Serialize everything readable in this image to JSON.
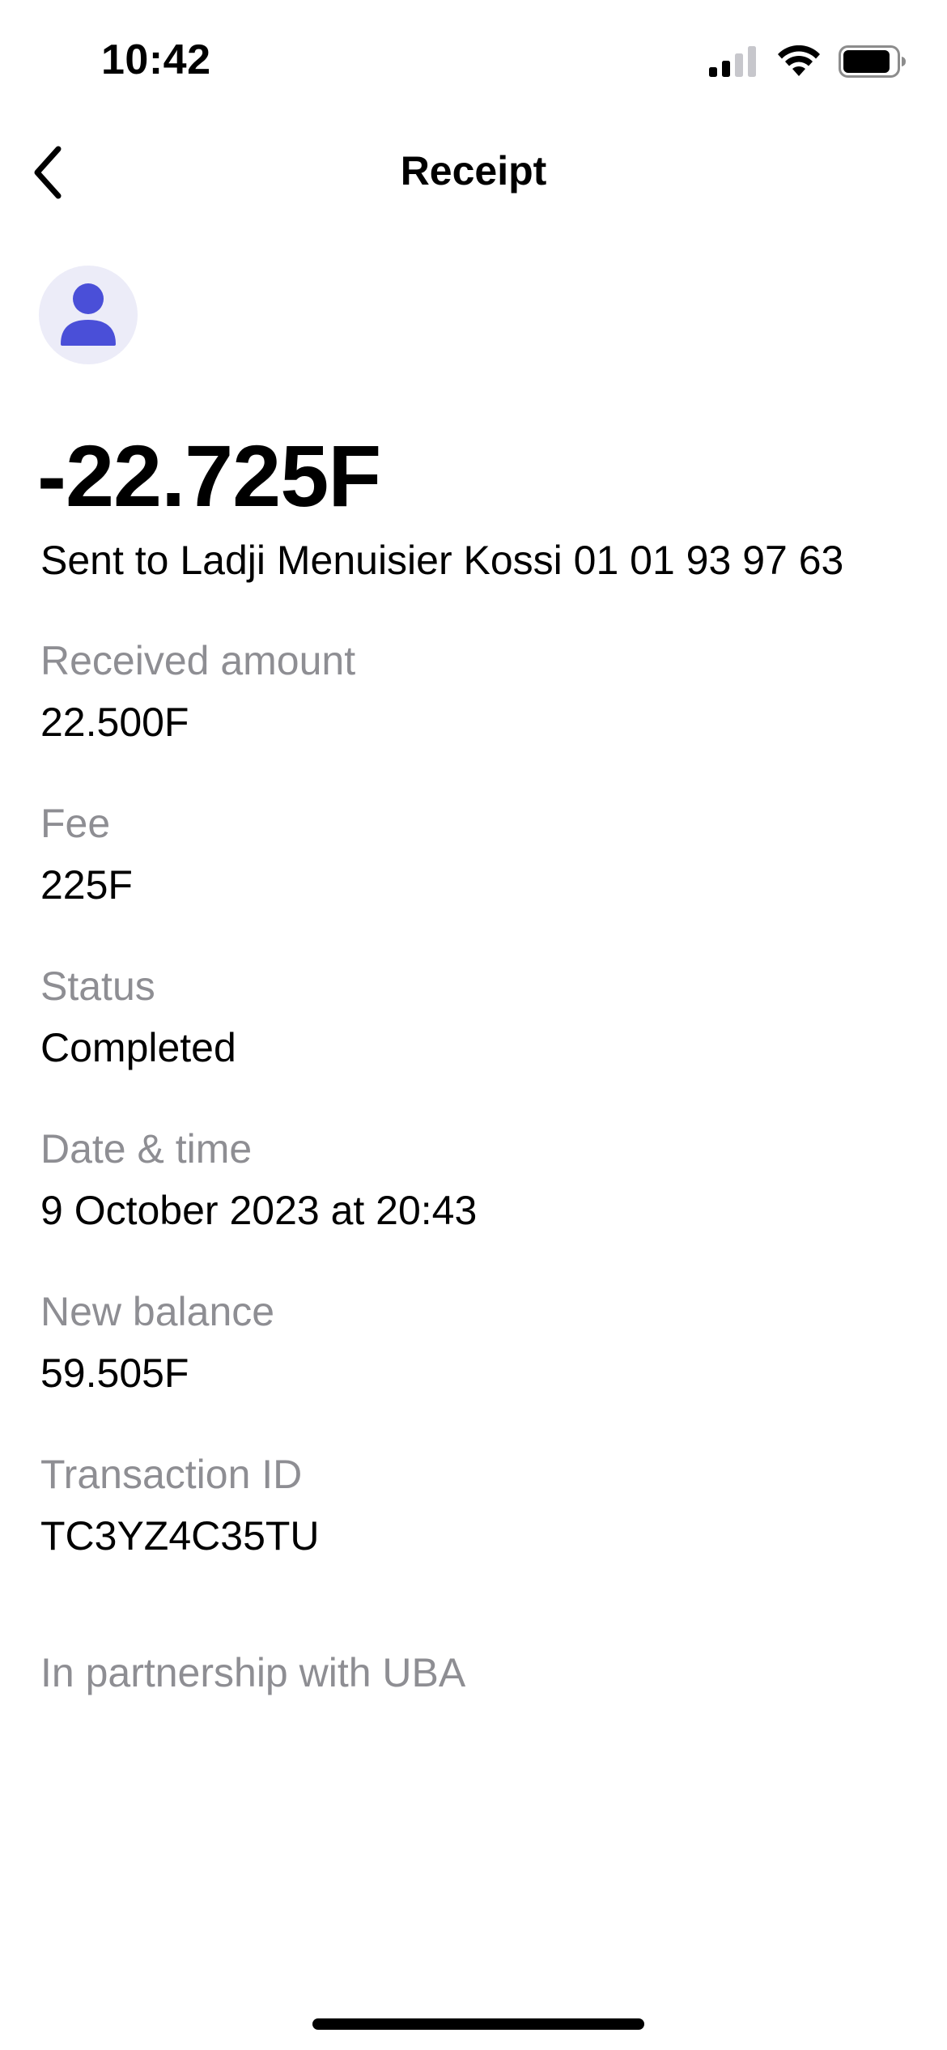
{
  "status_bar": {
    "time": "10:42",
    "icons": [
      "cellular-signal-icon",
      "wifi-icon",
      "battery-icon"
    ],
    "signal_bars_active": 2,
    "signal_bars_total": 4,
    "battery_level": 0.85
  },
  "nav": {
    "title": "Receipt",
    "back_icon": "chevron-left-icon"
  },
  "avatar": {
    "icon": "person-icon",
    "accent_color": "#4a4fd8",
    "background_color": "#ececf8"
  },
  "transaction": {
    "amount": "-22.725F",
    "recipient_line": "Sent to Ladji Menuisier Kossi 01 01 93 97 63",
    "details": [
      {
        "label": "Received amount",
        "value": "22.500F"
      },
      {
        "label": "Fee",
        "value": "225F"
      },
      {
        "label": "Status",
        "value": "Completed"
      },
      {
        "label": "Date & time",
        "value": "9 October 2023 at 20:43"
      },
      {
        "label": "New balance",
        "value": "59.505F"
      },
      {
        "label": "Transaction ID",
        "value": "TC3YZ4C35TU"
      }
    ]
  },
  "footer": {
    "partnership": "In partnership with UBA"
  }
}
